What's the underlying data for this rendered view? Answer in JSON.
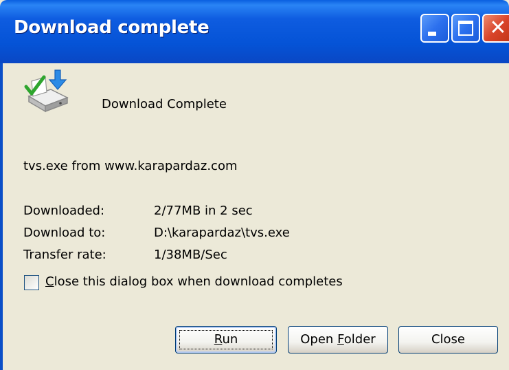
{
  "window": {
    "title": "Download complete",
    "title_bar_color": "#0553D6"
  },
  "title_buttons": {
    "minimize": "minimize",
    "maximize": "maximize",
    "close": "close"
  },
  "dialog": {
    "icon": "download-complete-icon",
    "heading": "Download Complete",
    "source": "tvs.exe from www.karapardaz.com",
    "details": [
      {
        "label": "Downloaded:",
        "value": "2/77MB in 2 sec"
      },
      {
        "label": "Download to:",
        "value": "D:\\karapardaz\\tvs.exe"
      },
      {
        "label": "Transfer rate:",
        "value": "1/38MB/Sec"
      }
    ],
    "checkbox": {
      "label_accel": "C",
      "label_rest": "lose this dialog box when download completes",
      "checked": false
    }
  },
  "buttons": {
    "run_accel": "R",
    "run_rest": "un",
    "open_folder_pre": "Open ",
    "open_folder_accel": "F",
    "open_folder_rest": "older",
    "close": "Close"
  }
}
